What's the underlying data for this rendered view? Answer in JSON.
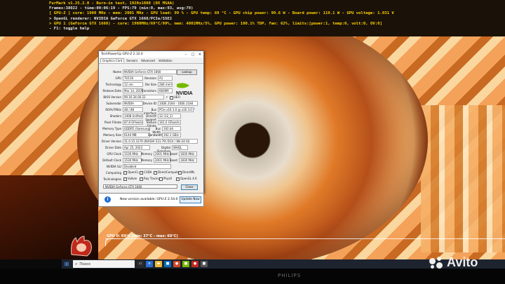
{
  "osd": {
    "line1": "FurMark v1.25.2.0 - Burn-in test, 1920x1080 (0X MSAA)",
    "line2": "Frames:38022 - time:00:06:19 - FPS:79 (min:0, max:93, avg:79)",
    "line3": "[ GPU-Z ] core: 1980 MHz - mem: 2001 MHz - GPU load: 99 % - GPU temp: 69 °C - GPU chip power: 99.6 W - Board power: 119.1 W - GPU voltage: 1.031 V",
    "line4": "> OpenGL renderer: NVIDIA GeForce GTX 1660/PCIe/SSE2",
    "line5": "> GPU 1 (GeForce GTX 1660) - core: 1980MHz/69°C/99%, mem: 4001MHz/5%, GPU power: 100.1% TDP, fan: 62%, limits:[power:1, temp:0, volt:0, OV:0]",
    "line6": "- F1: toggle help"
  },
  "graph": {
    "label": "GPU 0: 69°C (min: 37°C - max: 69°C)"
  },
  "gpuz": {
    "title": "TechPowerUp GPU-Z 2.32.0",
    "tabs": [
      "Graphics Card",
      "Sensors",
      "Advanced",
      "Validation"
    ],
    "lookup": "Lookup",
    "fields": {
      "name_label": "Name",
      "name": "NVIDIA GeForce GTX 1660",
      "gpu_label": "GPU",
      "gpu": "TU116",
      "revision_label": "Revision",
      "revision": "A1",
      "tech_label": "Technology",
      "tech": "12 nm",
      "diesize_label": "Die Size",
      "diesize": "284 mm²",
      "release_label": "Release Date",
      "release": "Mar 14, 2019",
      "transistors_label": "Transistors",
      "transistors": "6600M",
      "bios_label": "BIOS Version",
      "bios": "90.16.34.00.22",
      "subvendor_label": "Subvendor",
      "subvendor": "NVIDIA",
      "deviceid_label": "Device ID",
      "deviceid": "10DE 2184 - 10DE 2184",
      "rops_label": "ROPs/TMUs",
      "rops": "48 / 88",
      "bus_label": "Bus Interface",
      "bus": "PCIe x16 3.0 @ x16 3.0",
      "shaders_label": "Shaders",
      "shaders": "1408 Unified",
      "directx_label": "DirectX Support",
      "directx": "12 (12_1)",
      "pixel_label": "Pixel Fillrate",
      "pixel": "87.8 GPixel/s",
      "texture_label": "Texture Fillrate",
      "texture": "161.0 GTexel/s",
      "memtype_label": "Memory Type",
      "memtype": "GDDR5 (Samsung)",
      "buswidth_label": "Bus Width",
      "buswidth": "192 bit",
      "memsize_label": "Memory Size",
      "memsize": "6144 MB",
      "bandwidth_label": "Bandwidth",
      "bandwidth": "192.1 GB/s",
      "driver_label": "Driver Version",
      "driver": "31.0.15.3179 (NVIDIA 531.79) DCH / Win10 64",
      "driverdate_label": "Driver Date",
      "driverdate": "Apr 25, 2023",
      "digsig_label": "Digital Signature",
      "digsig": "WHQL",
      "gpuclock_label": "GPU Clock",
      "gpuclock": "1530 MHz",
      "mem_label": "Memory",
      "mem": "2001 MHz",
      "boost_label": "Boost",
      "boost": "1830 MHz",
      "defclock_label": "Default Clock",
      "defclock": "1530 MHz",
      "defmem": "2001 MHz",
      "defboost": "1830 MHz",
      "sli_label": "NVIDIA SLI",
      "sli": "Disabled",
      "computing_label": "Computing",
      "technologies_label": "Technologies",
      "computing": [
        "OpenCL",
        "CUDA",
        "DirectCompute",
        "DirectML"
      ],
      "technologies": [
        "Vulkan",
        "Ray Tracing",
        "PhysX",
        "OpenGL 4.6"
      ]
    },
    "uefi": "UEFI",
    "gpu_select": "NVIDIA GeForce GTX 1660",
    "close": "Close"
  },
  "update": {
    "message": "New version available: GPU-Z 2.54.0",
    "button": "Update Now"
  },
  "taskbar": {
    "search_placeholder": "Поиск"
  },
  "monitor": {
    "brand": "PHILIPS"
  },
  "watermark": {
    "text": "Avito"
  }
}
